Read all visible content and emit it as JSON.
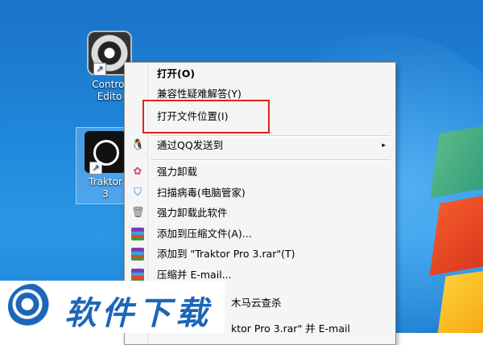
{
  "desktop": {
    "icons": [
      {
        "label_line1": "Control",
        "label_line2": "Edito"
      },
      {
        "label_line1": "Traktor",
        "label_line2": "3"
      }
    ]
  },
  "context_menu": {
    "items": [
      {
        "label": "打开(O)",
        "bold": true
      },
      {
        "label": "兼容性疑难解答(Y)"
      },
      {
        "label": "打开文件位置(I)"
      },
      {
        "label": "通过QQ发送到"
      },
      {
        "label": "强力卸载"
      },
      {
        "label": "扫描病毒(电脑管家)"
      },
      {
        "label": "强力卸载此软件"
      },
      {
        "label": "添加到压缩文件(A)..."
      },
      {
        "label": "添加到 \"Traktor Pro 3.rar\"(T)"
      },
      {
        "label": "压缩并 E-mail..."
      },
      {
        "label": "木马云查杀"
      },
      {
        "label": "ktor Pro 3.rar\" 并 E-mail"
      }
    ],
    "submenu_arrow": "▸"
  },
  "overlay_logo": {
    "text": "软件下载"
  },
  "colors": {
    "highlight_box": "#e2231a",
    "brand": "#1c66b8"
  }
}
